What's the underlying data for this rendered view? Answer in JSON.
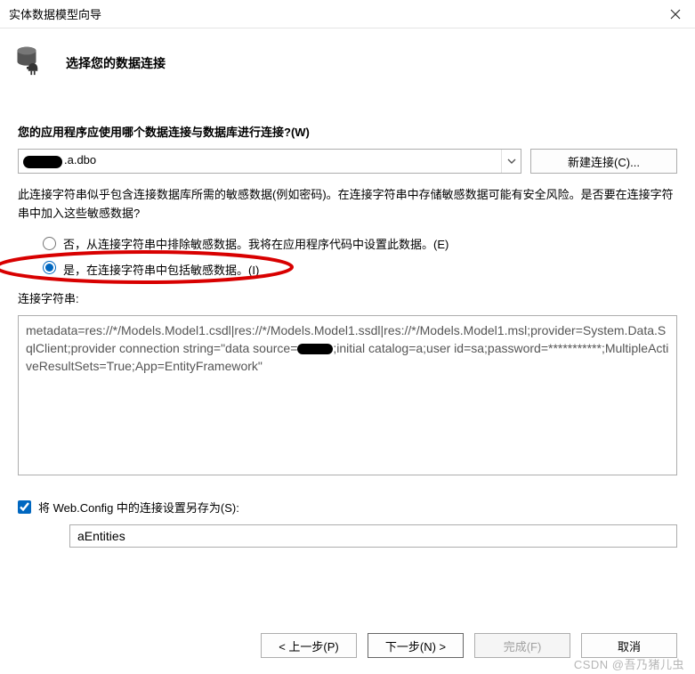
{
  "window": {
    "title": "实体数据模型向导"
  },
  "header": {
    "title": "选择您的数据连接"
  },
  "body": {
    "question": "您的应用程序应使用哪个数据连接与数据库进行连接?(W)",
    "connection_value": ".a.dbo",
    "new_connection_label": "新建连接(C)...",
    "warning_text": "此连接字符串似乎包含连接数据库所需的敏感数据(例如密码)。在连接字符串中存储敏感数据可能有安全风险。是否要在连接字符串中加入这些敏感数据?",
    "radio_no": "否，从连接字符串中排除敏感数据。我将在应用程序代码中设置此数据。(E)",
    "radio_yes": "是，在连接字符串中包括敏感数据。(I)",
    "cs_label": "连接字符串:",
    "cs_text_1": "metadata=res://*/Models.Model1.csdl|res://*/Models.Model1.ssdl|res://*/Models.Model1.msl;provider=System.Data.SqlClient;provider connection string=\"data source=",
    "cs_text_2": ";initial catalog=a;user id=sa;password=***********;MultipleActiveResultSets=True;App=EntityFramework\"",
    "save_label": "将 Web.Config 中的连接设置另存为(S):",
    "save_name": "aEntities"
  },
  "footer": {
    "prev": "< 上一步(P)",
    "next": "下一步(N) >",
    "finish": "完成(F)",
    "cancel": "取消"
  },
  "watermark": "CSDN @吾乃猪儿虫"
}
